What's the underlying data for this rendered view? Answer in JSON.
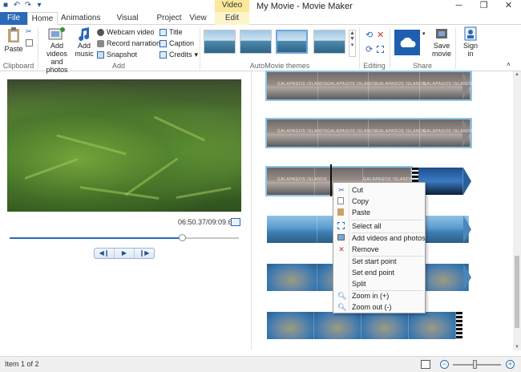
{
  "window": {
    "title": "My Movie - Movie Maker",
    "contextual_tab_group": "Video Tools",
    "controls": [
      "minimize-icon",
      "restore-icon",
      "close-icon"
    ]
  },
  "quick_access": [
    "save-icon",
    "undo-icon",
    "redo-icon",
    "customize-icon"
  ],
  "tabs": [
    "File",
    "Home",
    "Animations",
    "Visual Effects",
    "Project",
    "View",
    "Edit"
  ],
  "active_tab": "Home",
  "ribbon": {
    "clipboard": {
      "paste": "Paste",
      "label": "Clipboard"
    },
    "add": {
      "add_videos_line1": "Add videos",
      "add_videos_line2": "and photos",
      "add_music_line1": "Add",
      "add_music_line2": "music",
      "webcam": "Webcam video",
      "narration": "Record narration",
      "snapshot": "Snapshot",
      "title": "Title",
      "caption": "Caption",
      "credits": "Credits",
      "label": "Add"
    },
    "themes": {
      "label": "AutoMovie themes",
      "count": 4,
      "selected_index": 2
    },
    "editing": {
      "label": "Editing"
    },
    "share": {
      "save_movie_line1": "Save",
      "save_movie_line2": "movie",
      "label": "Share"
    },
    "signin": {
      "line1": "Sign",
      "line2": "in"
    }
  },
  "preview": {
    "time": "06:50.37/09:09.61",
    "seek_progress": 0.75,
    "transport": [
      "previous-frame-icon",
      "play-icon",
      "next-frame-icon"
    ]
  },
  "storyboard": {
    "caption_text": "GALAPAGOS ISLANDS",
    "rows": 6
  },
  "context_menu": {
    "items": [
      {
        "label": "Cut",
        "icon": "cut-icon",
        "enabled": true
      },
      {
        "label": "Copy",
        "icon": "copy-icon",
        "enabled": true
      },
      {
        "label": "Paste",
        "icon": "paste-icon",
        "enabled": true
      },
      {
        "label": "Select all",
        "icon": "select-all-icon",
        "enabled": true
      },
      {
        "label": "Add videos and photos",
        "icon": "add-media-icon",
        "enabled": true
      },
      {
        "label": "Remove",
        "icon": "remove-icon",
        "enabled": true
      },
      {
        "label": "Set start point",
        "icon": "",
        "enabled": true
      },
      {
        "label": "Set end point",
        "icon": "",
        "enabled": true
      },
      {
        "label": "Split",
        "icon": "",
        "enabled": true
      },
      {
        "label": "Zoom in (+)",
        "icon": "zoom-in-icon",
        "enabled": true
      },
      {
        "label": "Zoom out (-)",
        "icon": "zoom-out-icon",
        "enabled": true
      }
    ]
  },
  "status": {
    "text": "Item 1 of 2",
    "zoom_level": 0.42
  },
  "colors": {
    "accent": "#2a6ab8",
    "contextual": "#fbe999",
    "selection": "#8cc5e8"
  }
}
